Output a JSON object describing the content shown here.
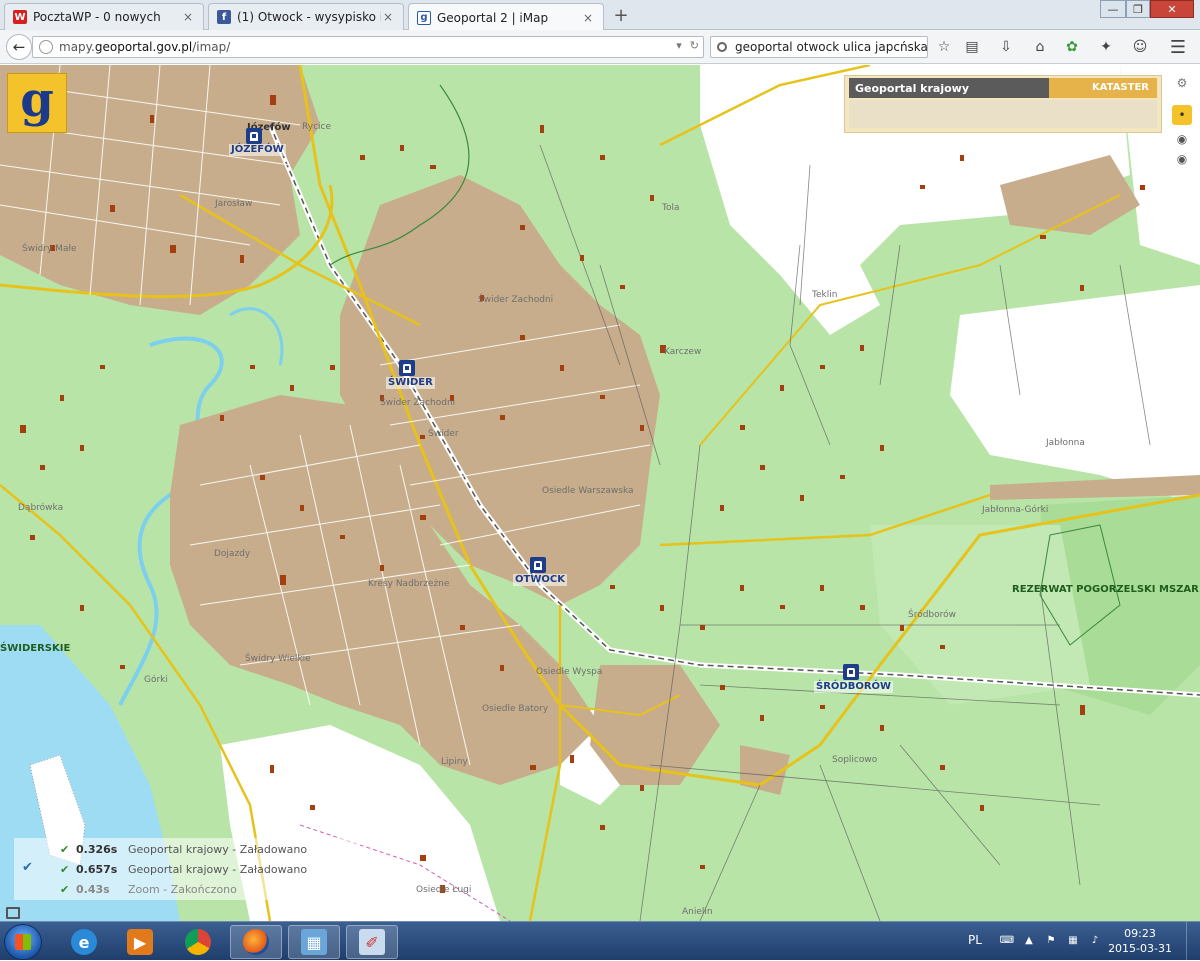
{
  "browser": {
    "tabs": [
      {
        "label": "PocztaWP - 0 nowych",
        "icon": "wp-icon",
        "icon_text": "W",
        "icon_color": "#d81e1e"
      },
      {
        "label": "(1) Otwock - wysypisko i ru...",
        "icon": "facebook-icon",
        "icon_text": "f",
        "icon_color": "#3b5998"
      },
      {
        "label": "Geoportal 2 | iMap",
        "icon": "geoportal-icon",
        "icon_text": "g",
        "icon_color": "#2b5aa8"
      }
    ],
    "tab_close_glyph": "×",
    "new_tab_glyph": "+",
    "url_prefix": "mapy.",
    "url_domain": "geoportal.gov.pl",
    "url_suffix": "/imap/",
    "search_text": "geoportal otwock ulica japcńska",
    "window_buttons": {
      "minimize": "—",
      "restore": "❐",
      "close": "✕"
    }
  },
  "map": {
    "logo_letter": "g",
    "layer_switcher": {
      "active": "Geoportal krajowy",
      "other": "KATASTER"
    },
    "place_labels": [
      "Józefów",
      "Rycice",
      "Jarosław",
      "Świdry Małe",
      "Świder Zachodni",
      "Świder Zachodni",
      "Świder",
      "Dąbrówka",
      "Dojazdy",
      "Kresy Nadbrzeżne",
      "Świdry Wielkie",
      "Górki",
      "Osiedle Warszawska",
      "Osiedle Wyspa",
      "Osiedle Batory",
      "Lipiny",
      "Osiedle Ługi",
      "Anielin",
      "Teklin",
      "Tola",
      "Karczew",
      "Jabłonna",
      "Jabłonna-Górki",
      "Śródborów",
      "Soplicowo"
    ],
    "nature_labels": [
      "REZERWAT POGORZELSKI MSZAR",
      "ŚWIDERSKIE"
    ],
    "stations": [
      "JÓZEFÓW",
      "ŚWIDER",
      "OTWOCK",
      "ŚRÓDBORÓW"
    ],
    "status": [
      {
        "time": "0.326s",
        "text": "Geoportal krajowy - Załadowano"
      },
      {
        "time": "0.657s",
        "text": "Geoportal krajowy - Załadowano"
      },
      {
        "time": "0.43s",
        "text": "Zoom - Zakończono"
      }
    ],
    "check_glyph": "✔"
  },
  "taskbar": {
    "apps": [
      "windows-explorer",
      "internet-explorer",
      "media-player",
      "chrome",
      "firefox",
      "network-app",
      "paint"
    ],
    "language": "PL",
    "time": "09:23",
    "date": "2015-03-31"
  }
}
